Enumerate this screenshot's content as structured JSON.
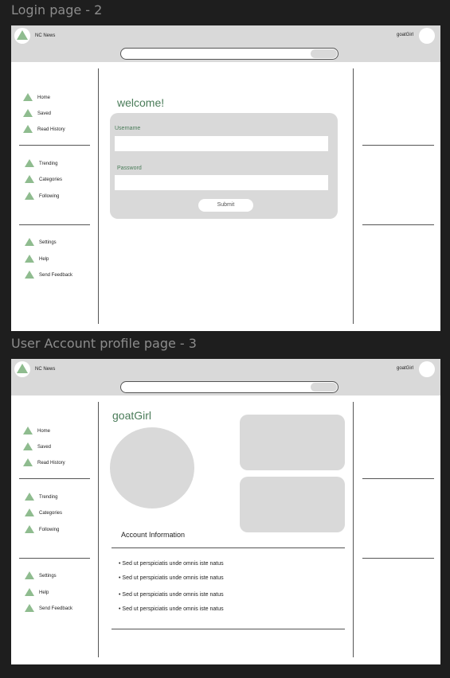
{
  "frames": {
    "login": {
      "label": "Login page - 2",
      "brand": "NC News",
      "user": "goatGirl",
      "welcome": "welcome!",
      "username_label": "Username",
      "password_label": "Password",
      "submit_label": "Submit"
    },
    "profile": {
      "label": "User Account profile page - 3",
      "brand": "NC News",
      "user": "goatGirl",
      "name": "goatGirl",
      "account_info_title": "Account Information",
      "account_items": [
        "Sed ut perspiciatis unde omnis iste natus",
        "Sed ut perspiciatis unde omnis iste natus",
        "Sed ut perspiciatis unde omnis iste natus",
        "Sed ut perspiciatis unde omnis iste natus"
      ]
    }
  },
  "nav": {
    "group1": [
      "Home",
      "Saved",
      "Read History"
    ],
    "group2": [
      "Trending",
      "Categories",
      "Following"
    ],
    "group3": [
      "Settings",
      "Help",
      "Send Feedback"
    ]
  },
  "colors": {
    "accent": "#8fbc8f",
    "heading": "#4a7c59",
    "placeholder_gray": "#d9d9d9",
    "canvas": "#1e1e1e"
  },
  "icons": {
    "logo": "triangle-logo-icon",
    "nav": "triangle-icon"
  }
}
